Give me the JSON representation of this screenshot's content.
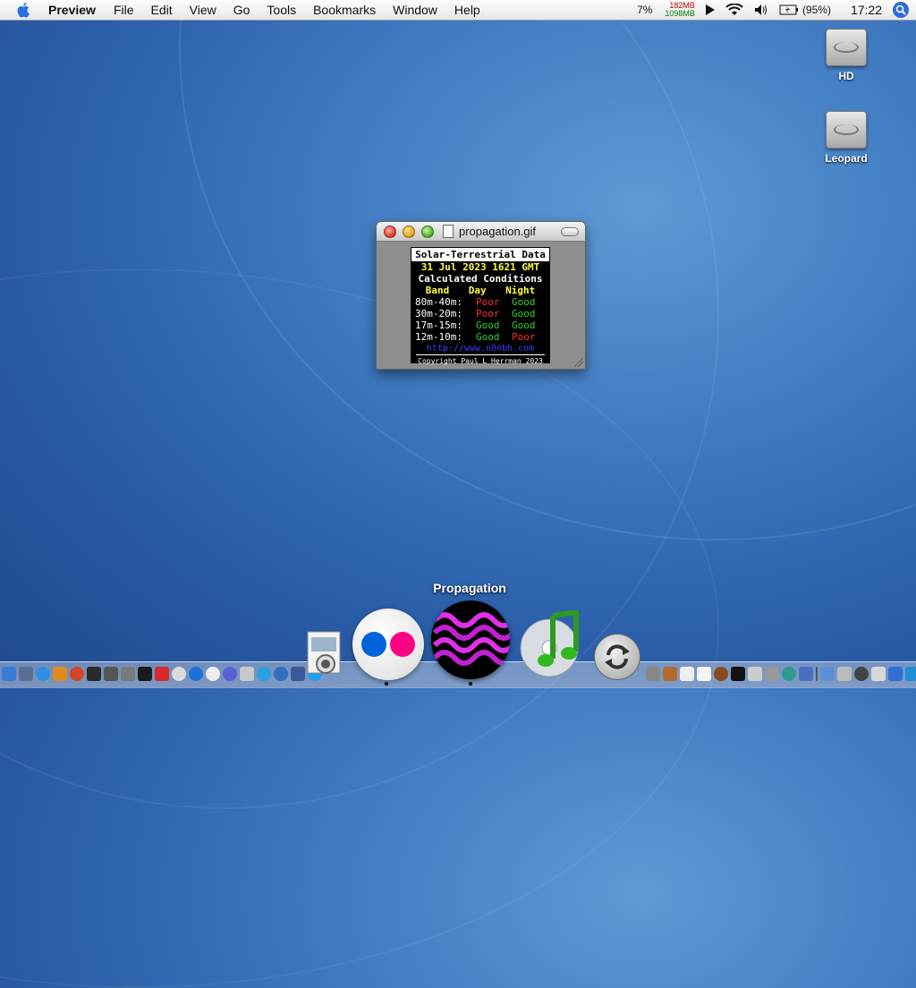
{
  "menubar": {
    "app_name": "Preview",
    "items": [
      "File",
      "Edit",
      "View",
      "Go",
      "Tools",
      "Bookmarks",
      "Window",
      "Help"
    ],
    "cpu": "7%",
    "mem_used": "182MB",
    "mem_free": "1098MB",
    "battery": "(95%)",
    "clock": "17:22"
  },
  "desktop": {
    "drives": [
      {
        "label": "HD"
      },
      {
        "label": "Leopard"
      }
    ]
  },
  "window": {
    "title": "propagation.gif"
  },
  "propagation": {
    "header": "Solar-Terrestrial Data",
    "date": "31 Jul 2023 1621 GMT",
    "subtitle": "Calculated Conditions",
    "col_band": "Band",
    "col_day": "Day",
    "col_night": "Night",
    "rows": [
      {
        "band": "80m-40m:",
        "day": "Poor",
        "night": "Good"
      },
      {
        "band": "30m-20m:",
        "day": "Poor",
        "night": "Good"
      },
      {
        "band": "17m-15m:",
        "day": "Good",
        "night": "Good"
      },
      {
        "band": "12m-10m:",
        "day": "Good",
        "night": "Poor"
      }
    ],
    "url": "http://www.n0nbh.com",
    "copyright": "Copyright Paul L Herrman 2023"
  },
  "dock": {
    "hover_label": "Propagation",
    "big_icons": [
      "preview-icon",
      "flickr-icon",
      "propagation-icon",
      "itunes-icon",
      "sync-icon"
    ]
  },
  "colors": {
    "poor": "#ff2a2a",
    "good": "#2fcf2f",
    "date_yellow": "#ffff3a",
    "flickr_blue": "#0063dc",
    "flickr_pink": "#ff0084"
  }
}
